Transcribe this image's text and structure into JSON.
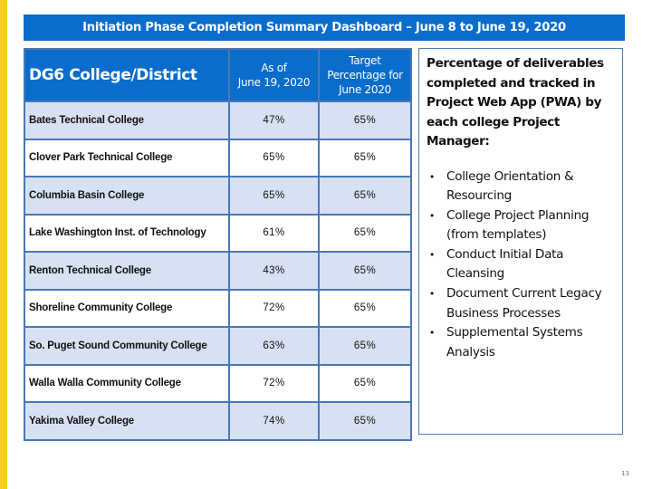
{
  "slide": {
    "title": "Initiation Phase Completion Summary Dashboard – June 8 to June 19, 2020",
    "page_number": "13",
    "colors": {
      "accent_yellow": "#F5CF1B",
      "header_blue": "#0A6CCB",
      "row_shade": "#D8E1F2",
      "border_blue": "#4A78B6"
    }
  },
  "table": {
    "headers": {
      "name": "DG6 College/District",
      "as_of_line1": "As of",
      "as_of_line2": "June 19, 2020",
      "target_line1": "Target",
      "target_line2": "Percentage for",
      "target_line3": "June 2020"
    },
    "rows": [
      {
        "name": "Bates Technical College",
        "as_of": "47%",
        "target": "65%"
      },
      {
        "name": "Clover Park Technical College",
        "as_of": "65%",
        "target": "65%"
      },
      {
        "name": "Columbia Basin College",
        "as_of": "65%",
        "target": "65%"
      },
      {
        "name": "Lake Washington Inst. of Technology",
        "as_of": "61%",
        "target": "65%"
      },
      {
        "name": "Renton Technical College",
        "as_of": "43%",
        "target": "65%"
      },
      {
        "name": "Shoreline Community College",
        "as_of": "72%",
        "target": "65%"
      },
      {
        "name": "So. Puget Sound Community College",
        "as_of": "63%",
        "target": "65%"
      },
      {
        "name": "Walla Walla Community College",
        "as_of": "72%",
        "target": "65%"
      },
      {
        "name": "Yakima Valley College",
        "as_of": "74%",
        "target": "65%"
      }
    ]
  },
  "info_panel": {
    "heading": "Percentage of deliverables completed and tracked in Project Web App (PWA) by each college Project Manager:",
    "bullet_icon": "bullet-dot",
    "items": [
      "College Orientation & Resourcing",
      "College Project Planning (from templates)",
      "Conduct Initial Data Cleansing",
      "Document Current Legacy Business Processes",
      "Supplemental Systems Analysis"
    ]
  }
}
